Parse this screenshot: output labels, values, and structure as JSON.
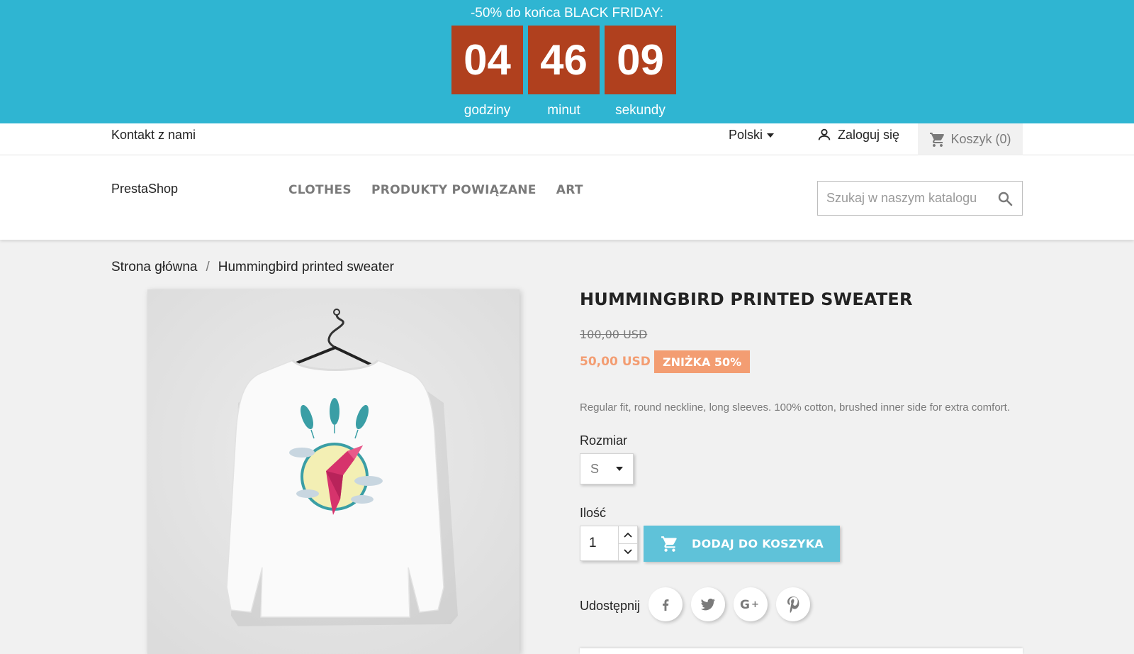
{
  "promo": {
    "title": "-50% do końca BLACK FRIDAY:",
    "countdown": [
      {
        "value": "04",
        "label": "godziny"
      },
      {
        "value": "46",
        "label": "minut"
      },
      {
        "value": "09",
        "label": "sekundy"
      }
    ],
    "background_color": "#2fb5d2",
    "box_color": "#b0401e"
  },
  "topnav": {
    "contact": "Kontakt z nami",
    "language": "Polski",
    "login": "Zaloguj się",
    "cart": "Koszyk (0)"
  },
  "header": {
    "logo": "PrestaShop",
    "menu": [
      "CLOTHES",
      "PRODUKTY POWIĄZANE",
      "ART"
    ],
    "search_placeholder": "Szukaj w naszym katalogu"
  },
  "breadcrumb": {
    "home": "Strona główna",
    "separator": "/",
    "current": "Hummingbird printed sweater"
  },
  "product": {
    "title": "HUMMINGBIRD PRINTED SWEATER",
    "old_price": "100,00 USD",
    "new_price": "50,00 USD",
    "discount": "ZNIŻKA 50%",
    "description": "Regular fit, round neckline, long sleeves. 100% cotton, brushed inner side for extra comfort.",
    "size_label": "Rozmiar",
    "size_value": "S",
    "quantity_label": "Ilość",
    "quantity_value": "1",
    "add_to_cart": "DODAJ DO KOSZYKA",
    "share_label": "Udostępnij",
    "share_icons": [
      "facebook-icon",
      "twitter-icon",
      "google-plus-icon",
      "pinterest-icon"
    ],
    "accent_color": "#f39d72",
    "button_color": "#5fc2d9"
  }
}
